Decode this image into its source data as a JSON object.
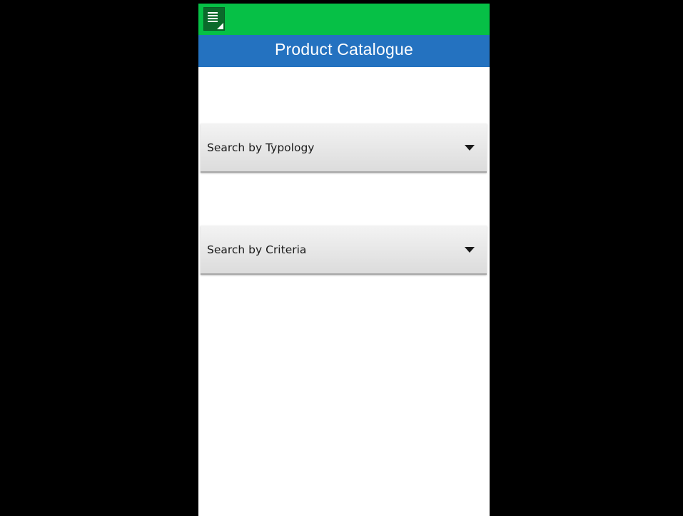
{
  "app": {
    "icon": "notes-app-icon"
  },
  "header": {
    "title": "Product Catalogue"
  },
  "filters": [
    {
      "label": "Search by Typology",
      "icon": "dropdown-arrow-icon"
    },
    {
      "label": "Search by Criteria",
      "icon": "dropdown-arrow-icon"
    }
  ],
  "colors": {
    "status_bar": "#06c046",
    "title_bar": "#2472c0",
    "dropdown_bg": "#e4e4e4"
  }
}
